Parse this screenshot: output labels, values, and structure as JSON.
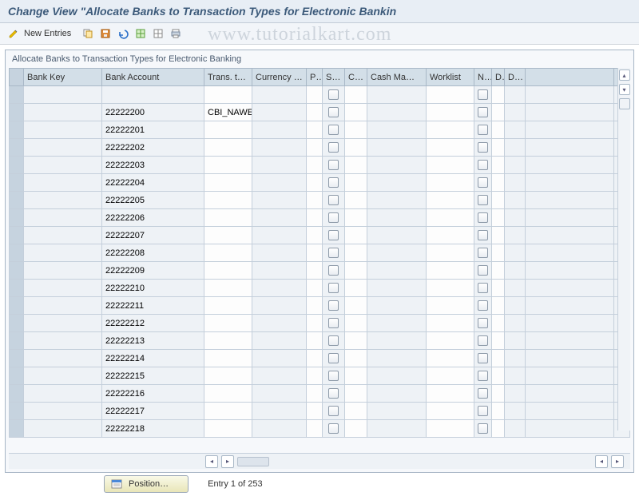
{
  "header": {
    "title": "Change View \"Allocate Banks to Transaction Types for Electronic Bankin"
  },
  "watermark": "www.tutorialkart.com",
  "toolbar": {
    "new_entries": "New Entries"
  },
  "panel": {
    "title": "Allocate Banks to Transaction Types for Electronic Banking"
  },
  "columns": {
    "bank_key": "Bank Key",
    "bank_account": "Bank Account",
    "trans_t": "Trans. t…",
    "currency": "Currency c…",
    "p": "P…",
    "su": "Su…",
    "co": "Co…",
    "cash_ma": "Cash Ma…",
    "worklist": "Worklist",
    "n": "N…",
    "d1": "D",
    "d2": "D…"
  },
  "rows": [
    {
      "bank_account": "",
      "trans_t": ""
    },
    {
      "bank_account": "22222200",
      "trans_t": "CBI_NAWE"
    },
    {
      "bank_account": "22222201",
      "trans_t": ""
    },
    {
      "bank_account": "22222202",
      "trans_t": ""
    },
    {
      "bank_account": "22222203",
      "trans_t": ""
    },
    {
      "bank_account": "22222204",
      "trans_t": ""
    },
    {
      "bank_account": "22222205",
      "trans_t": ""
    },
    {
      "bank_account": "22222206",
      "trans_t": ""
    },
    {
      "bank_account": "22222207",
      "trans_t": ""
    },
    {
      "bank_account": "22222208",
      "trans_t": ""
    },
    {
      "bank_account": "22222209",
      "trans_t": ""
    },
    {
      "bank_account": "22222210",
      "trans_t": ""
    },
    {
      "bank_account": "22222211",
      "trans_t": ""
    },
    {
      "bank_account": "22222212",
      "trans_t": ""
    },
    {
      "bank_account": "22222213",
      "trans_t": ""
    },
    {
      "bank_account": "22222214",
      "trans_t": ""
    },
    {
      "bank_account": "22222215",
      "trans_t": ""
    },
    {
      "bank_account": "22222216",
      "trans_t": ""
    },
    {
      "bank_account": "22222217",
      "trans_t": ""
    },
    {
      "bank_account": "22222218",
      "trans_t": ""
    }
  ],
  "footer": {
    "position_button": "Position…",
    "entry_text": "Entry 1 of 253"
  }
}
